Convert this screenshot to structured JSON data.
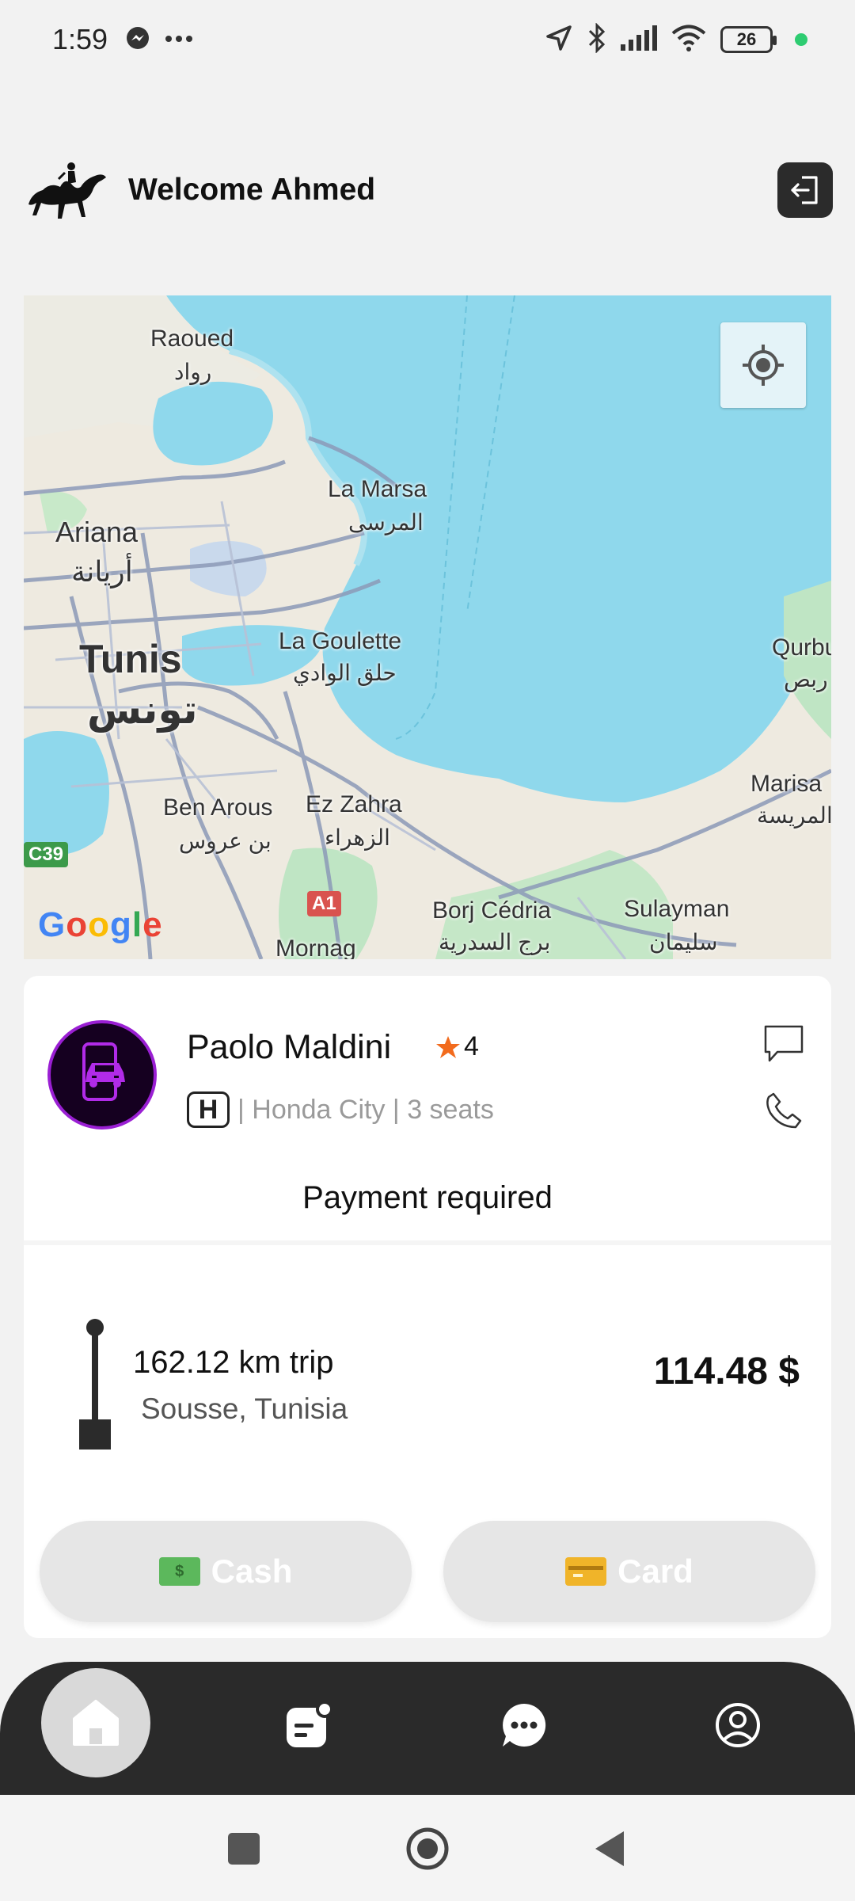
{
  "status_bar": {
    "time": "1:59",
    "battery": "26",
    "icons": [
      "messenger-icon",
      "more-dots-icon",
      "location-arrow-icon",
      "bluetooth-icon",
      "signal-icon",
      "wifi-icon",
      "battery-icon"
    ]
  },
  "header": {
    "welcome_text": "Welcome Ahmed"
  },
  "map": {
    "labels": {
      "raoued": "Raoued",
      "raoued_ar": "رواد",
      "la_marsa": "La Marsa",
      "la_marsa_ar": "المرسى",
      "ariana": "Ariana",
      "ariana_ar": "أريانة",
      "tunis": "Tunis",
      "tunis_ar": "تونس",
      "la_goulette": "La Goulette",
      "la_goulette_ar": "حلق الوادي",
      "qurbus": "Qurbu",
      "qurbus_ar": "ربص",
      "marisa": "Marisa",
      "marisa_ar": "المريسة",
      "ben_arous": "Ben Arous",
      "ben_arous_ar": "بن عروس",
      "ez_zahra": "Ez Zahra",
      "ez_zahra_ar": "الزهراء",
      "borj_cedria": "Borj Cédria",
      "borj_cedria_ar": "برج السدرية",
      "sulayman": "Sulayman",
      "sulayman_ar": "سليمان",
      "mornag": "Mornag",
      "c39": "C39",
      "a1": "A1"
    },
    "google": "Google"
  },
  "driver": {
    "name": "Paolo Maldini",
    "rating": "4",
    "car": "| Honda City | 3 seats",
    "car_brand_mark": "H"
  },
  "payment": {
    "title": "Payment required",
    "distance": "162.12 km trip",
    "destination": "Sousse, Tunisia",
    "price": "114.48 $",
    "cash_label": "Cash",
    "card_label": "Card"
  },
  "nav": {
    "items": [
      "home-icon",
      "trips-icon",
      "chat-icon",
      "profile-icon"
    ]
  },
  "colors": {
    "accent_purple": "#9a1fd3",
    "dark_nav": "#2a2a2a",
    "sea": "#8fd8ec",
    "star": "#f26b1d"
  }
}
